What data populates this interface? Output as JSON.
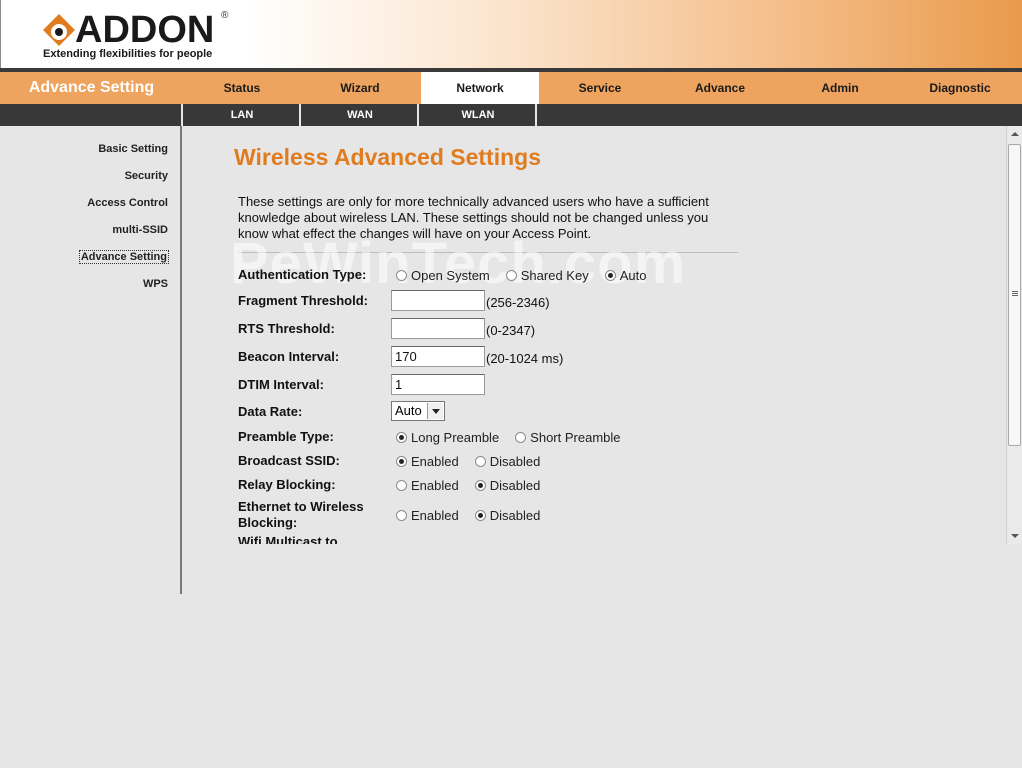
{
  "brand": {
    "name": "ADDON",
    "reg_mark": "®",
    "tagline": "Extending flexibilities for people",
    "accent": "#e99a4b"
  },
  "nav": {
    "title": "Advance Setting",
    "tabs": [
      "Status",
      "Wizard",
      "Network",
      "Service",
      "Advance",
      "Admin",
      "Diagnostic"
    ],
    "active_tab": "Network"
  },
  "subnav": {
    "tabs": [
      "LAN",
      "WAN",
      "WLAN"
    ]
  },
  "sidebar": {
    "items": [
      "Basic Setting",
      "Security",
      "Access Control",
      "multi-SSID",
      "Advance Setting",
      "WPS"
    ],
    "active": "Advance Setting"
  },
  "page": {
    "title": "Wireless Advanced Settings",
    "intro": "These settings are only for more technically advanced users who have a sufficient knowledge about wireless LAN. These settings should not be changed unless you know what effect the changes will have on your Access Point.",
    "watermark": "PeWinTech.com"
  },
  "form": {
    "auth_type": {
      "label": "Authentication Type:",
      "options": [
        "Open System",
        "Shared Key",
        "Auto"
      ],
      "selected": "Auto"
    },
    "fragment": {
      "label": "Fragment Threshold:",
      "value": "",
      "hint": "(256-2346)"
    },
    "rts": {
      "label": "RTS Threshold:",
      "value": "",
      "hint": "(0-2347)"
    },
    "beacon": {
      "label": "Beacon Interval:",
      "value": "170",
      "hint": "(20-1024 ms)"
    },
    "dtim": {
      "label": "DTIM Interval:",
      "value": "1"
    },
    "data_rate": {
      "label": "Data Rate:",
      "value": "Auto"
    },
    "preamble": {
      "label": "Preamble Type:",
      "options": [
        "Long Preamble",
        "Short Preamble"
      ],
      "selected": "Long Preamble"
    },
    "broadcast_ssid": {
      "label": "Broadcast SSID:",
      "options": [
        "Enabled",
        "Disabled"
      ],
      "selected": "Enabled"
    },
    "relay_blocking": {
      "label": "Relay Blocking:",
      "options": [
        "Enabled",
        "Disabled"
      ],
      "selected": "Disabled"
    },
    "eth_wireless_blocking": {
      "label_line1": "Ethernet to Wireless",
      "label_line2": "Blocking:",
      "options": [
        "Enabled",
        "Disabled"
      ],
      "selected": "Disabled"
    },
    "wifi_multicast": {
      "label": "Wifi Multicast to"
    }
  }
}
